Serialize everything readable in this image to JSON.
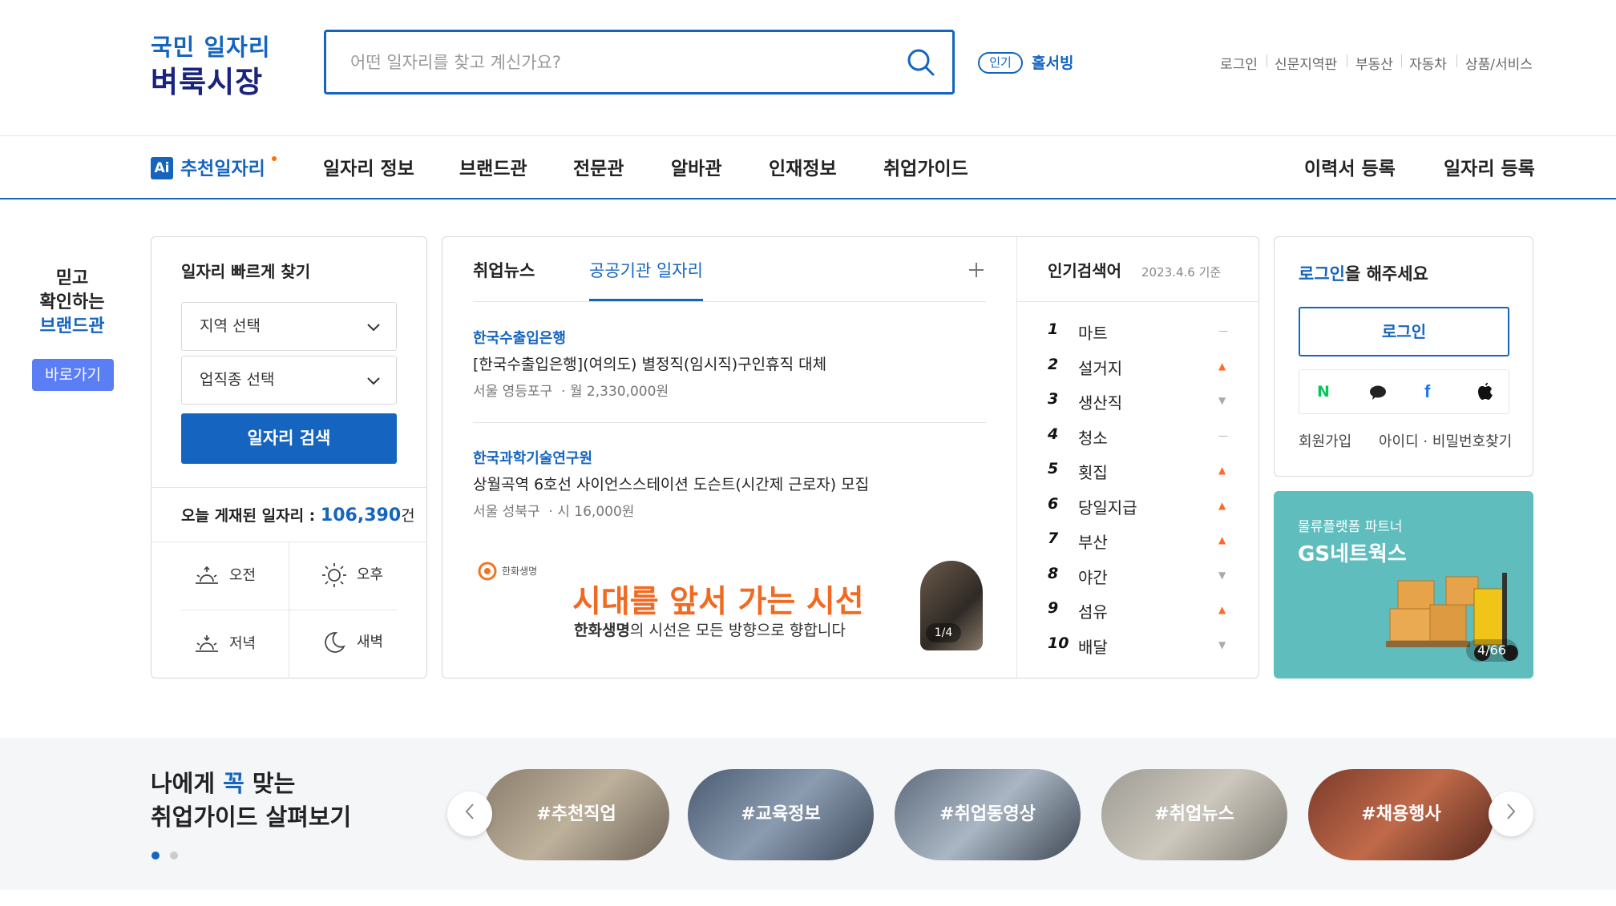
{
  "header": {
    "logo_line1": "국민 일자리",
    "logo_line2": "벼룩시장",
    "search_placeholder": "어떤 일자리를 찾고 계신가요?",
    "popular_badge": "인기",
    "popular_keyword": "홀서빙",
    "util_links": [
      "로그인",
      "신문지역판",
      "부동산",
      "자동차",
      "상품/서비스"
    ]
  },
  "nav": {
    "ai_badge": "Ai",
    "items": [
      "추천일자리",
      "일자리 정보",
      "브랜드관",
      "전문관",
      "알바관",
      "인재정보",
      "취업가이드"
    ],
    "right_items": [
      "이력서 등록",
      "일자리 등록"
    ]
  },
  "side_brand": {
    "line1": "믿고",
    "line2": "확인하는",
    "line3": "브랜드관",
    "button": "바로가기"
  },
  "quick_search": {
    "title": "일자리 빠르게 찾기",
    "region_select": "지역 선택",
    "job_select": "업직종 선택",
    "search_button": "일자리 검색",
    "today_label": "오늘 게재된 일자리 :",
    "today_count": "106,390",
    "today_unit": "건",
    "times": [
      "오전",
      "오후",
      "저녁",
      "새벽"
    ]
  },
  "news": {
    "tabs": [
      "취업뉴스",
      "공공기관 일자리"
    ],
    "active_tab": "공공기관 일자리",
    "items": [
      {
        "company": "한국수출입은행",
        "title": "[한국수출입은행](여의도) 별정직(임시직)구인휴직 대체",
        "location": "서울 영등포구",
        "pay": "월 2,330,000원"
      },
      {
        "company": "한국과학기술연구원",
        "title": "상월곡역 6호선 사이언스스테이션 도슨트(시간제 근로자) 모집",
        "location": "서울 성북구",
        "pay": "시 16,000원"
      }
    ],
    "ad": {
      "brand": "한화생명",
      "headline": "시대를 앞서 가는 시선",
      "sub_bold": "한화생명",
      "sub_rest": "의 시선은 모든 방향으로 향합니다",
      "counter": "1/4"
    }
  },
  "popular": {
    "title": "인기검색어",
    "date": "2023.4.6 기준",
    "items": [
      {
        "rank": "1",
        "word": "마트",
        "trend": "same"
      },
      {
        "rank": "2",
        "word": "설거지",
        "trend": "up"
      },
      {
        "rank": "3",
        "word": "생산직",
        "trend": "down"
      },
      {
        "rank": "4",
        "word": "청소",
        "trend": "same"
      },
      {
        "rank": "5",
        "word": "횟집",
        "trend": "up"
      },
      {
        "rank": "6",
        "word": "당일지급",
        "trend": "up"
      },
      {
        "rank": "7",
        "word": "부산",
        "trend": "up"
      },
      {
        "rank": "8",
        "word": "야간",
        "trend": "down"
      },
      {
        "rank": "9",
        "word": "섬유",
        "trend": "up"
      },
      {
        "rank": "10",
        "word": "배달",
        "trend": "down"
      }
    ]
  },
  "login_box": {
    "prompt_highlight": "로그인",
    "prompt_rest": "을 해주세요",
    "button": "로그인",
    "social": [
      "naver-icon",
      "kakao-icon",
      "facebook-icon",
      "apple-icon"
    ],
    "join": "회원가입",
    "find": "아이디 · 비밀번호찾기"
  },
  "partner_ad": {
    "label": "물류플랫폼 파트너",
    "name": "GS네트웍스",
    "counter": "4/66"
  },
  "guide": {
    "line1_a": "나에게 ",
    "line1_b": "꼭",
    "line1_c": " 맞는",
    "line2": "취업가이드 살펴보기",
    "pills": [
      "#추천직업",
      "#교육정보",
      "#취업동영상",
      "#취업뉴스",
      "#채용행사"
    ]
  },
  "colors": {
    "primary": "#1565c0",
    "accent": "#5b7ef5",
    "teal": "#5fbdbd"
  }
}
